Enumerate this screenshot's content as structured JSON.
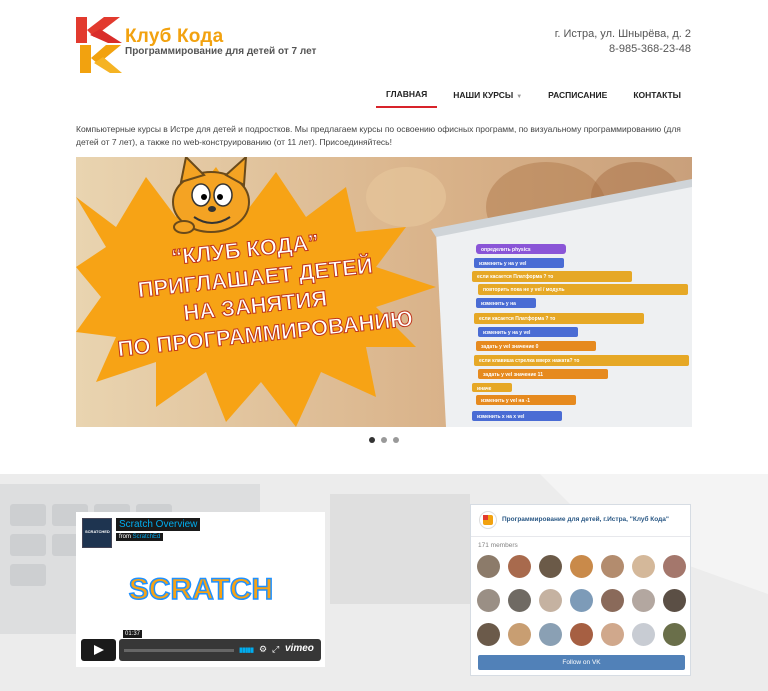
{
  "brand": {
    "name": "Клуб Кода",
    "tagline": "Программирование для детей от 7 лет"
  },
  "contact": {
    "address": "г. Истра, ул. Шнырёва, д. 2",
    "phone": "8-985-368-23-48"
  },
  "nav": {
    "items": [
      {
        "label": "ГЛАВНАЯ",
        "active": true
      },
      {
        "label": "НАШИ КУРСЫ",
        "active": false
      },
      {
        "label": "РАСПИСАНИЕ",
        "active": false
      },
      {
        "label": "КОНТАКТЫ",
        "active": false
      }
    ]
  },
  "intro": "Компьютерные курсы в Истре для детей и подростков. Мы предлагаем курсы по освоению офисных программ, по визуальному программированию (для детей от 7 лет), а также по web-конструированию (от 11 лет). Присоединяйтесь!",
  "slider": {
    "headline_lines": [
      "“КЛУБ КОДА”",
      "ПРИГЛАШАЕТ ДЕТЕЙ",
      "НА ЗАНЯТИЯ",
      "ПО ПРОГРАММИРОВАНИЮ"
    ],
    "blocks": [
      "определить physics",
      "изменить y на y vel",
      "если касается Платформа ? то",
      "повторить пока не y vel / модуль",
      "изменить y на",
      "если касается Платформа ? то",
      "изменить y на y vel",
      "задать y vel значение 0",
      "если клавиша стрелка вверх нажата? то",
      "задать y vel значение 11",
      "иначе",
      "изменить y vel на -1",
      "изменить x на x vel"
    ],
    "active_slide": 0,
    "slide_count": 3
  },
  "video": {
    "title": "Scratch Overview",
    "from_prefix": "from",
    "from_name": "ScratchEd",
    "thumb_label": "SCRATCHED",
    "logo_text": "SCRATCH",
    "time": "01:37",
    "provider": "vimeo"
  },
  "vk": {
    "group_name": "Программирование для детей, г.Истра, \"Клуб Кода\"",
    "members": "171 members",
    "follow_label": "Follow on VK",
    "faces": [
      "#8c7b6a",
      "#a86a4d",
      "#6b5a48",
      "#c98a4a",
      "#b38c6e",
      "#d4b89a",
      "#a4776c",
      "#9a8f85",
      "#6f6a63",
      "#c5b2a1",
      "#7d9bb8",
      "#8a6a5a",
      "#b3a7a0",
      "#5b4f45",
      "#6b5a4a",
      "#c89e72",
      "#8aa0b4",
      "#a65f42",
      "#d0a88c",
      "#c8ccd3",
      "#6a6f4a"
    ]
  }
}
